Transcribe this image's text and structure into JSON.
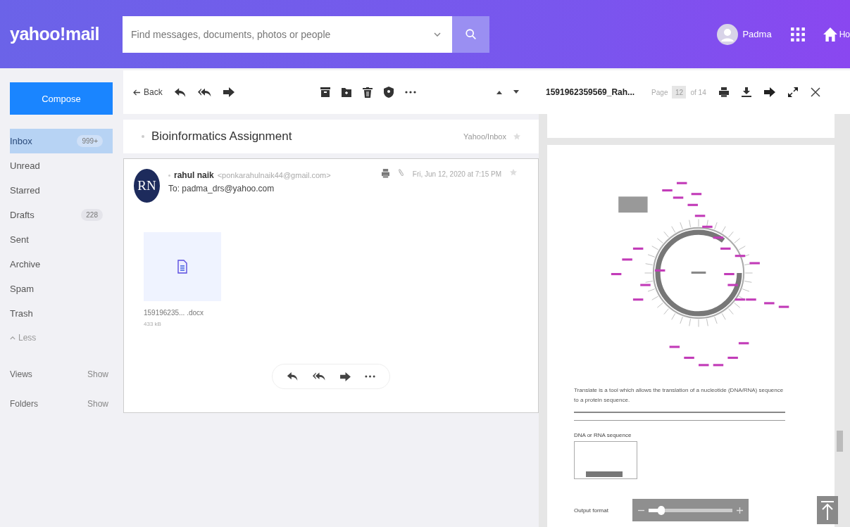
{
  "header": {
    "logo": "yahoo!mail",
    "search": {
      "placeholder": "Find messages, documents, photos or people"
    },
    "user": "Padma",
    "home": "Ho"
  },
  "sidebar": {
    "compose": "Compose",
    "folders": [
      {
        "label": "Inbox",
        "count": "999+",
        "selected": true
      },
      {
        "label": "Unread",
        "selected": false
      },
      {
        "label": "Starred",
        "selected": false
      },
      {
        "label": "Drafts",
        "count": "228",
        "selected": false
      },
      {
        "label": "Sent",
        "selected": false
      },
      {
        "label": "Archive",
        "selected": false
      },
      {
        "label": "Spam",
        "selected": false
      },
      {
        "label": "Trash",
        "selected": false
      }
    ],
    "less": "Less",
    "sections": [
      {
        "label": "Views",
        "action": "Show"
      },
      {
        "label": "Folders",
        "action": "Show"
      }
    ]
  },
  "toolbar": {
    "back": "Back"
  },
  "message": {
    "subject": "Bioinformatics Assignment",
    "location": "Yahoo/Inbox",
    "avatar": "RN",
    "sender": "rahul naik",
    "email": "<ponkarahulnaik44@gmail.com>",
    "to": "To: padma_drs@yahoo.com",
    "date": "Fri, Jun 12, 2020 at 7:15 PM",
    "attachment": {
      "name": "159196235... .docx",
      "size": "433 kB"
    }
  },
  "preview": {
    "filename": "1591962359569_Rah...",
    "page_label": "Page",
    "page": "12",
    "page_total": "of 14",
    "intro": "Translate is a tool which allows the translation of a nucleotide (DNA/RNA) sequence to a protein sequence.",
    "field_label": "DNA or RNA sequence",
    "output_label": "Output format",
    "zoom": {
      "level": 0.15
    }
  }
}
